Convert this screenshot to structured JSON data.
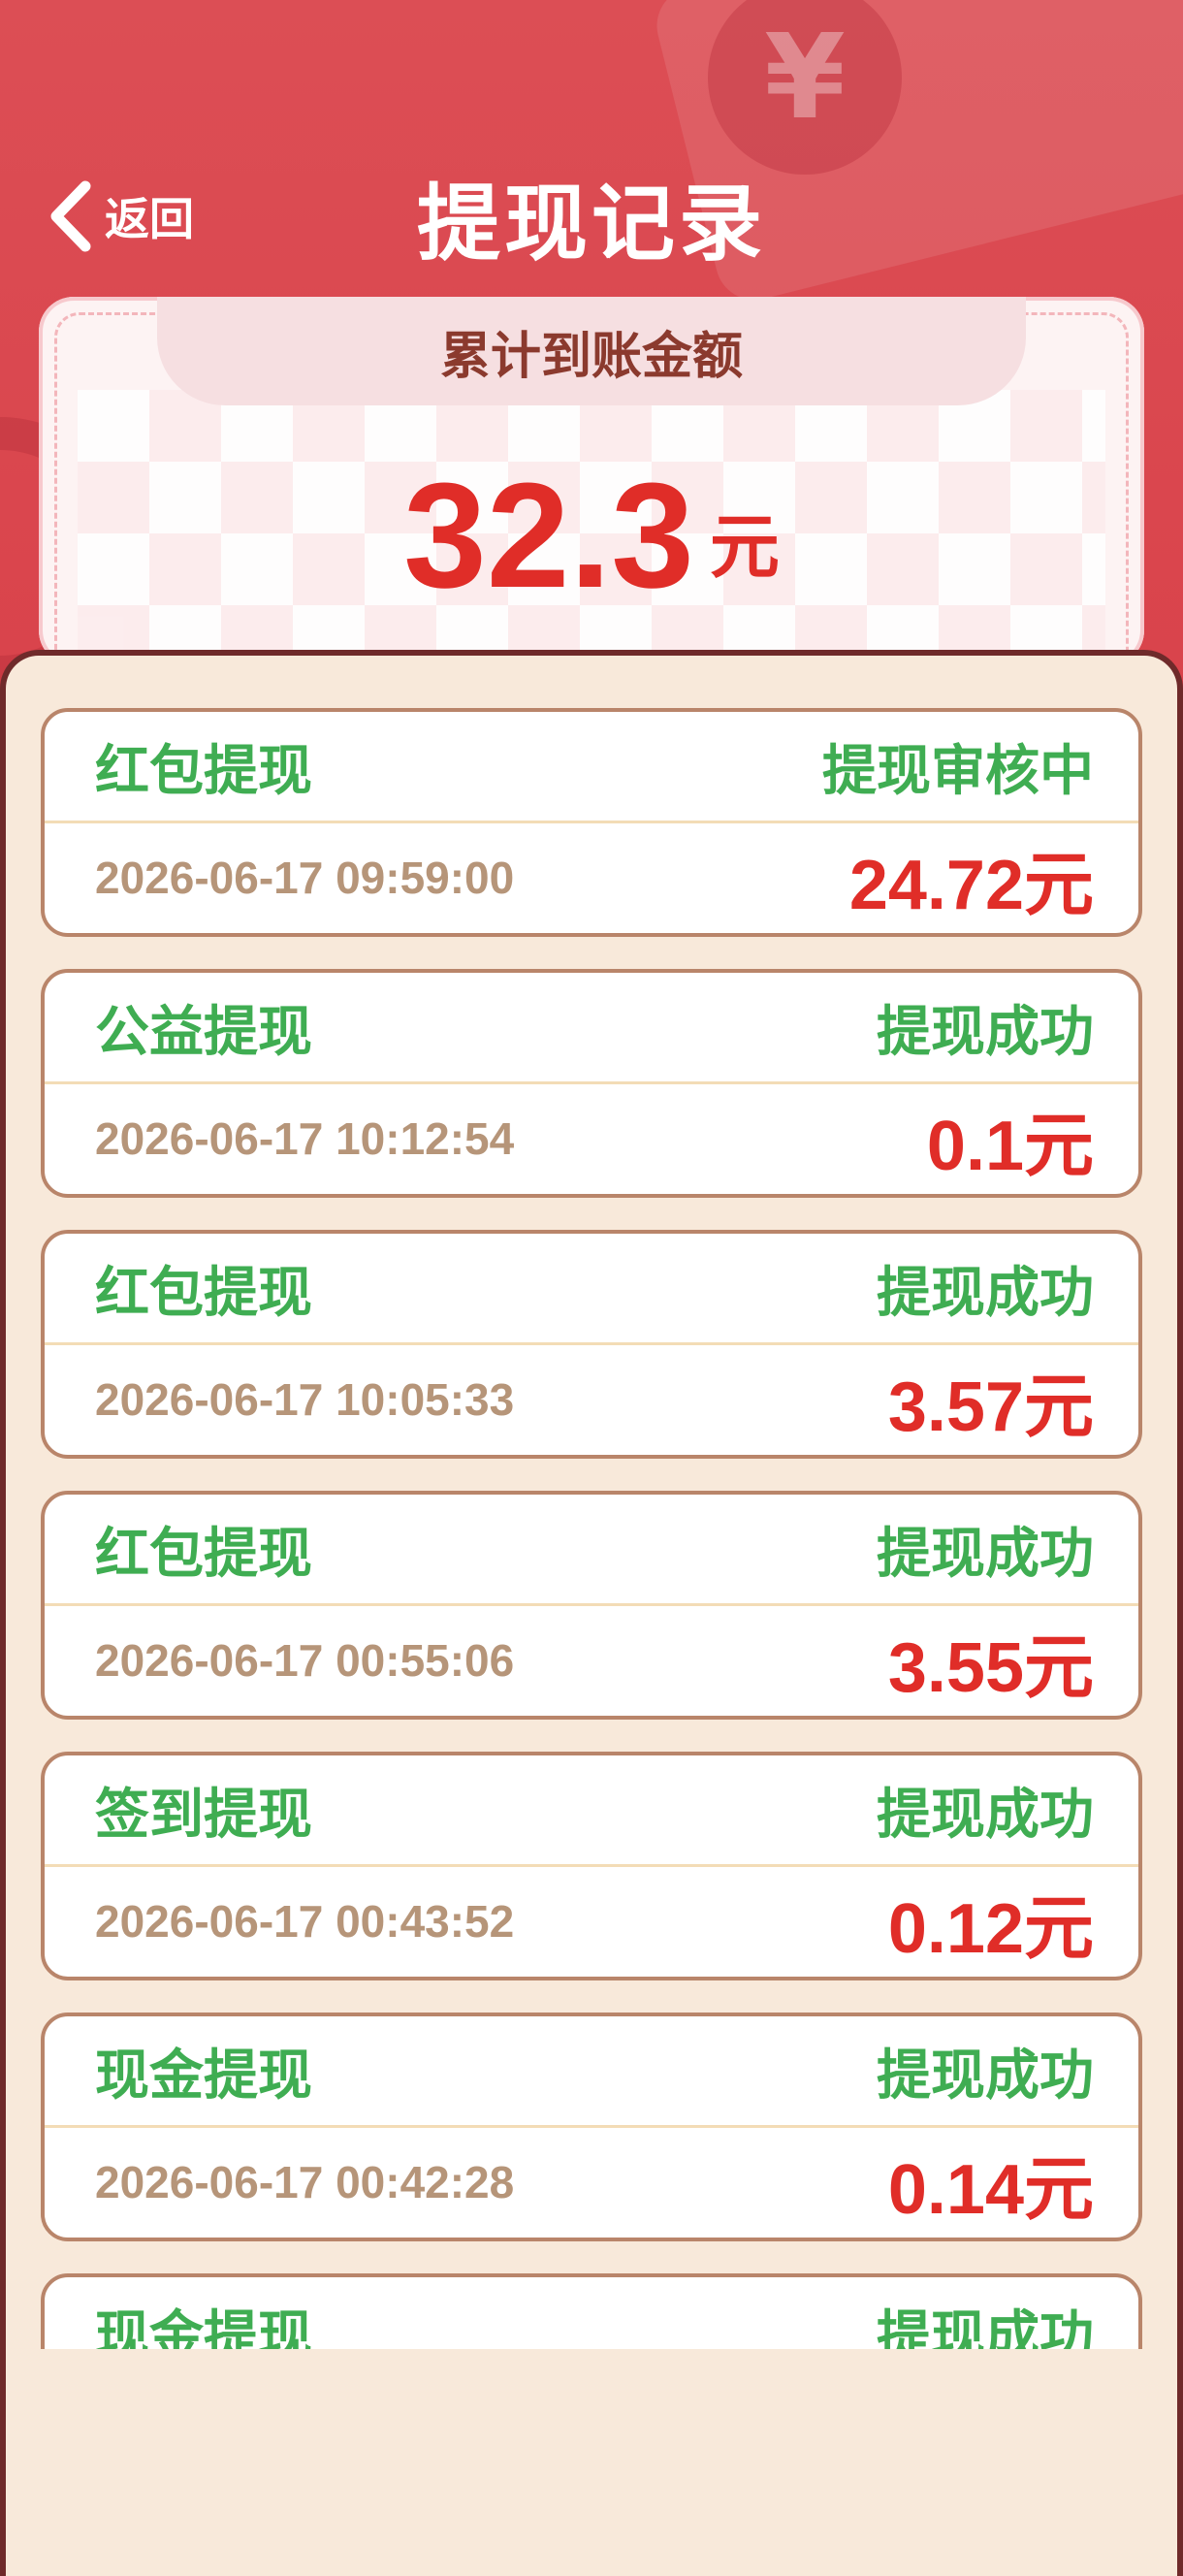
{
  "header": {
    "back_label": "返回",
    "title": "提现记录",
    "coin_symbol": "¥"
  },
  "summary": {
    "label": "累计到账金额",
    "amount": "32.3",
    "unit": "元"
  },
  "records": [
    {
      "type": "红包提现",
      "status": "提现审核中",
      "time": "2026-06-17 09:59:00",
      "amount": "24.72元"
    },
    {
      "type": "公益提现",
      "status": "提现成功",
      "time": "2026-06-17 10:12:54",
      "amount": "0.1元"
    },
    {
      "type": "红包提现",
      "status": "提现成功",
      "time": "2026-06-17 10:05:33",
      "amount": "3.57元"
    },
    {
      "type": "红包提现",
      "status": "提现成功",
      "time": "2026-06-17 00:55:06",
      "amount": "3.55元"
    },
    {
      "type": "签到提现",
      "status": "提现成功",
      "time": "2026-06-17 00:43:52",
      "amount": "0.12元"
    },
    {
      "type": "现金提现",
      "status": "提现成功",
      "time": "2026-06-17 00:42:28",
      "amount": "0.14元"
    },
    {
      "type": "现金提现",
      "status": "提现成功",
      "time": "",
      "amount": ""
    }
  ],
  "colors": {
    "header_red": "#dc4e55",
    "status_green": "#3fad52",
    "amount_red": "#e02d28",
    "background": "#f8e9da"
  }
}
